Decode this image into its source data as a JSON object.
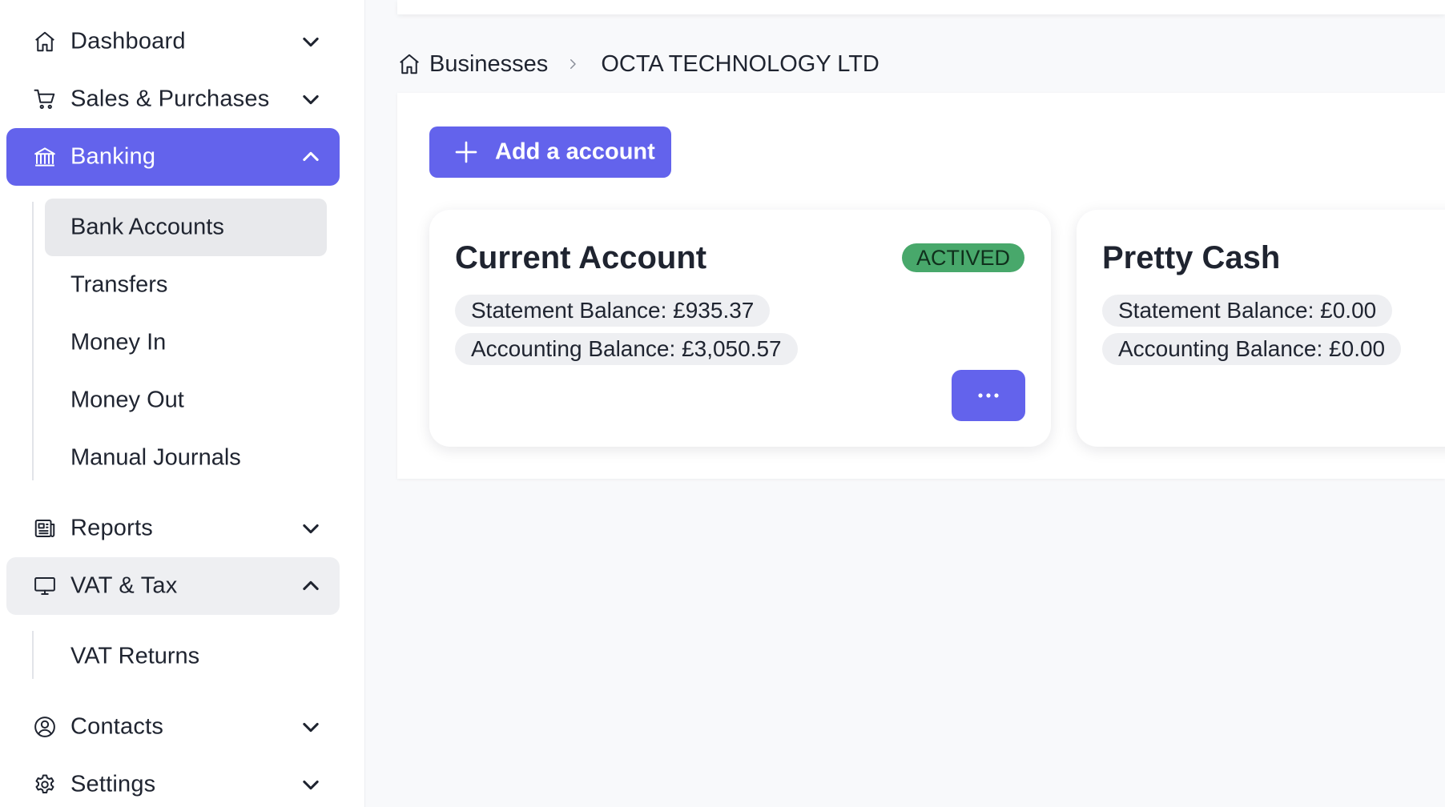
{
  "sidebar": {
    "items": [
      {
        "label": "Dashboard",
        "icon": "home-icon"
      },
      {
        "label": "Sales & Purchases",
        "icon": "cart-icon"
      },
      {
        "label": "Banking",
        "icon": "bank-icon"
      },
      {
        "label": "Reports",
        "icon": "newspaper-icon"
      },
      {
        "label": "VAT & Tax",
        "icon": "monitor-icon"
      },
      {
        "label": "Contacts",
        "icon": "user-circle-icon"
      },
      {
        "label": "Settings",
        "icon": "gear-icon"
      }
    ],
    "banking_sub": [
      "Bank Accounts",
      "Transfers",
      "Money In",
      "Money Out",
      "Manual Journals"
    ],
    "vat_sub": [
      "VAT Returns"
    ]
  },
  "breadcrumb": {
    "root": "Businesses",
    "current": "OCTA TECHNOLOGY LTD"
  },
  "toolbar": {
    "add_label": "Add a account"
  },
  "accounts": [
    {
      "name": "Current Account",
      "status": "ACTIVED",
      "statement_balance": "Statement Balance: £935.37",
      "accounting_balance": "Accounting Balance: £3,050.57"
    },
    {
      "name": "Pretty Cash",
      "statement_balance": "Statement Balance: £0.00",
      "accounting_balance": "Accounting Balance: £0.00"
    }
  ],
  "colors": {
    "accent": "#6363ec",
    "status_active": "#48a86b",
    "selected_bg": "#e8e9ec"
  }
}
